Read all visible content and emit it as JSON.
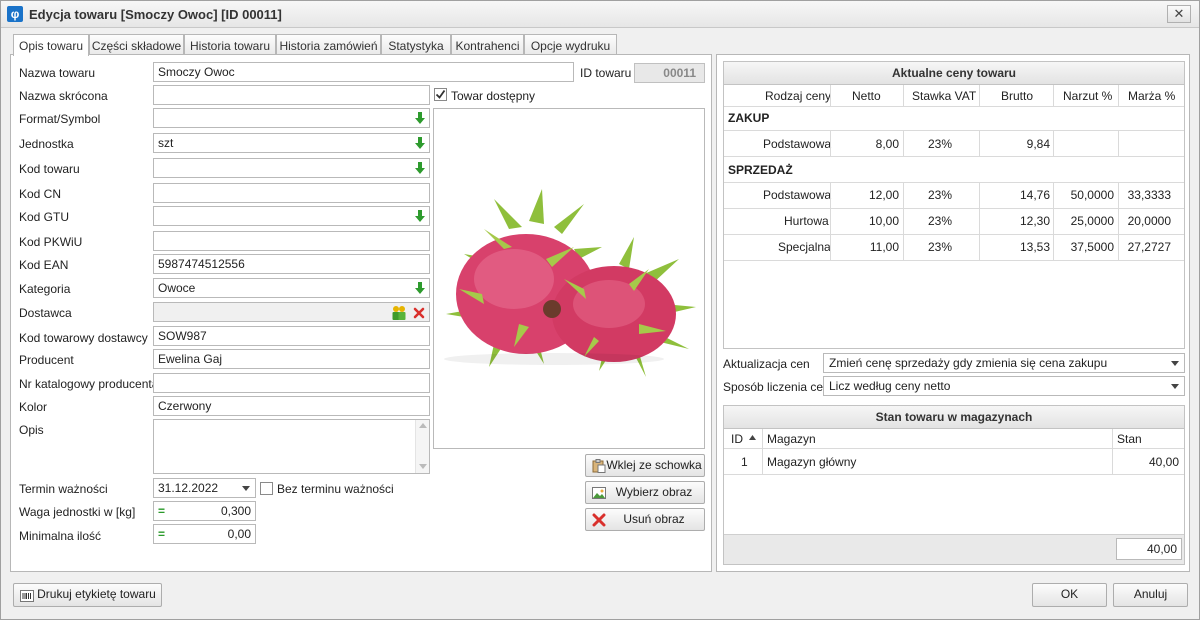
{
  "window": {
    "title": "Edycja towaru [Smoczy Owoc] [ID 00011]",
    "close_glyph": "✕",
    "app_icon_glyph": "φ"
  },
  "tabs": [
    "Opis towaru",
    "Części składowe",
    "Historia towaru",
    "Historia zamówień",
    "Statystyka",
    "Kontrahenci",
    "Opcje wydruku"
  ],
  "form": {
    "labels": {
      "nazwa": "Nazwa towaru",
      "nazwa_skr": "Nazwa skrócona",
      "format": "Format/Symbol",
      "jednostka": "Jednostka",
      "kod_towaru": "Kod towaru",
      "kod_cn": "Kod CN",
      "kod_gtu": "Kod GTU",
      "kod_pkwiu": "Kod PKWiU",
      "kod_ean": "Kod EAN",
      "kategoria": "Kategoria",
      "dostawca": "Dostawca",
      "kod_dost": "Kod towarowy dostawcy",
      "producent": "Producent",
      "nr_kat": "Nr katalogowy producenta",
      "kolor": "Kolor",
      "opis": "Opis",
      "termin": "Termin ważności",
      "waga": "Waga jednostki w [kg]",
      "min_ilosc": "Minimalna ilość",
      "id_towaru": "ID towaru"
    },
    "values": {
      "nazwa": "Smoczy Owoc",
      "nazwa_skr": "",
      "format": "",
      "jednostka": "szt",
      "kod_towaru": "",
      "kod_cn": "",
      "kod_gtu": "",
      "kod_pkwiu": "",
      "kod_ean": "5987474512556",
      "kategoria": "Owoce",
      "dostawca": "",
      "kod_dost": "SOW987",
      "producent": "Ewelina Gaj",
      "nr_kat": "",
      "kolor": "Czerwony",
      "opis": "",
      "termin": "31.12.2022",
      "waga": "0,300",
      "min_ilosc": "0,00",
      "id_towaru": "00011"
    },
    "towar_dostepny": {
      "label": "Towar dostępny",
      "checked": true
    },
    "bez_terminu": {
      "label": "Bez terminu ważności",
      "checked": false
    },
    "equals_glyph": "="
  },
  "image_buttons": {
    "paste": "Wklej ze schowka",
    "choose": "Wybierz obraz",
    "remove": "Usuń obraz"
  },
  "prices": {
    "title": "Aktualne ceny towaru",
    "columns": [
      "Rodzaj ceny",
      "Netto",
      "Stawka VAT",
      "Brutto",
      "Narzut %",
      "Marża %"
    ],
    "zakup_label": "ZAKUP",
    "sprzedaz_label": "SPRZEDAŻ",
    "zakup": [
      [
        "Podstawowa",
        "8,00",
        "23%",
        "9,84",
        "",
        ""
      ]
    ],
    "sprzedaz": [
      [
        "Podstawowa",
        "12,00",
        "23%",
        "14,76",
        "50,0000",
        "33,3333"
      ],
      [
        "Hurtowa",
        "10,00",
        "23%",
        "12,30",
        "25,0000",
        "20,0000"
      ],
      [
        "Specjalna",
        "11,00",
        "23%",
        "13,53",
        "37,5000",
        "27,2727"
      ]
    ]
  },
  "price_settings": {
    "aktualizacja_label": "Aktualizacja cen",
    "aktualizacja_value": "Zmień cenę sprzedaży gdy zmienia się cena zakupu",
    "sposob_label": "Sposób liczenia cen",
    "sposob_value": "Licz według ceny netto"
  },
  "stock": {
    "title": "Stan towaru w magazynach",
    "columns": [
      "ID",
      "Magazyn",
      "Stan"
    ],
    "rows": [
      [
        "1",
        "Magazyn główny",
        "40,00"
      ]
    ],
    "total": "40,00"
  },
  "footer": {
    "print_label": "Drukuj etykietę towaru",
    "ok": "OK",
    "cancel": "Anuluj"
  },
  "colors": {
    "accent": "#1a73c9",
    "green_arrow": "#2e9b2e",
    "red_x": "#d9302c",
    "fruit": "#d8416c",
    "fruit_tips": "#9cbf3a"
  }
}
